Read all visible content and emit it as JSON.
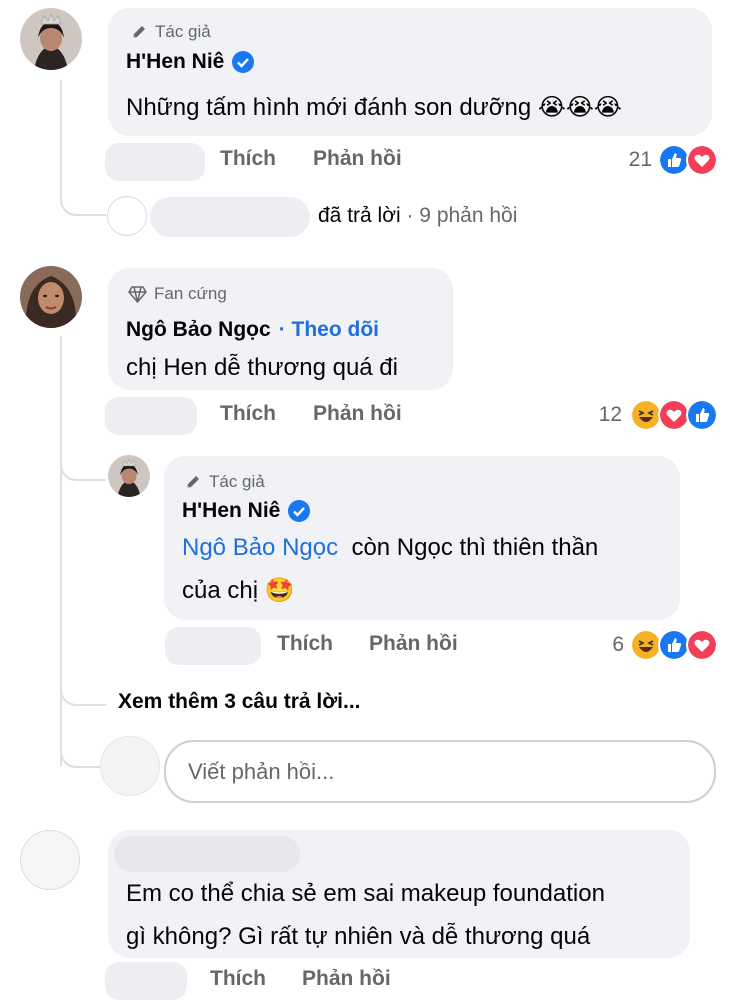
{
  "comment1": {
    "badge": "Tác giả",
    "name": "H'Hen Niê",
    "text": "Những tấm hình mới đánh son dưỡng",
    "emoji": "😭😭😭",
    "like": "Thích",
    "reply": "Phản hồi",
    "count": "21",
    "reactions": [
      "like-reaction",
      "love-reaction"
    ],
    "replies_summary": "đã trả lời",
    "replies_count": "· 9 phản hồi"
  },
  "comment2": {
    "badge": "Fan cứng",
    "name": "Ngô Bảo Ngọc",
    "follow": "· Theo dõi",
    "text": "chị Hen dễ thương quá đi",
    "like": "Thích",
    "reply": "Phản hồi",
    "count": "12",
    "reactions": [
      "haha-reaction",
      "love-reaction",
      "like-reaction"
    ]
  },
  "reply1": {
    "badge": "Tác giả",
    "name": "H'Hen Niê",
    "mention": "Ngô Bảo Ngọc",
    "text_line1": "còn Ngọc thì thiên thần",
    "text_line2": "của chị",
    "emoji": "🤩",
    "like": "Thích",
    "reply": "Phản hồi",
    "count": "6",
    "reactions": [
      "haha-reaction",
      "like-reaction",
      "love-reaction"
    ]
  },
  "more_replies": "Xem thêm 3 câu trả lời...",
  "reply_input": {
    "placeholder": "Viết phản hồi..."
  },
  "comment3": {
    "text_line1": "Em co thể chia sẻ em sai makeup foundation",
    "text_line2": "gì không? Gì rất tự nhiên và dễ thương quá",
    "like": "Thích",
    "reply": "Phản hồi"
  },
  "colors": {
    "link": "#216fdb",
    "bubble": "#f0f2f5",
    "muted": "#65676b",
    "like": "#1877f2",
    "love": "#f33e58",
    "haha": "#f7b125"
  }
}
